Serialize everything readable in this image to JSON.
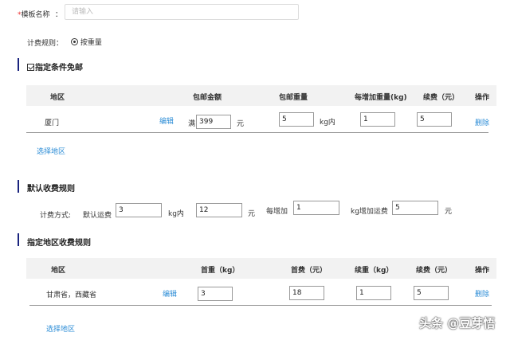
{
  "template_name": {
    "required_mark": "*",
    "label": "模板名称",
    "colon": "：",
    "placeholder": "请输入"
  },
  "billing_rule": {
    "label": "计费规则：",
    "option": "按重量"
  },
  "free_shipping": {
    "title": "指定条件免邮",
    "headers": [
      "地区",
      "包邮金额",
      "包邮重量",
      "每增加重量(kg)",
      "续费（元）",
      "操作"
    ],
    "row": {
      "region": "厦门",
      "edit": "编辑",
      "amount_prefix": "满",
      "amount": "399",
      "amount_unit": "元",
      "weight": "5",
      "weight_unit": "kg内",
      "per_weight": "1",
      "renew_fee": "5",
      "delete": "删除"
    },
    "select_region": "选择地区"
  },
  "default_rule": {
    "title": "默认收费规则",
    "method_label": "计费方式:",
    "default_fee_label": "默认运费",
    "default_weight": "3",
    "weight_unit": "kg内",
    "default_fee": "12",
    "fee_unit": "元",
    "each_add_label": "每增加",
    "each_add": "1",
    "add_fee_label": "kg增加运费",
    "add_fee": "5",
    "add_fee_unit": "元"
  },
  "region_rule": {
    "title": "指定地区收费规则",
    "headers": [
      "地区",
      "首重（kg）",
      "首费（元）",
      "续重（kg）",
      "续费（元）",
      "操作"
    ],
    "row": {
      "region": "甘肃省，西藏省",
      "edit": "编辑",
      "first_weight": "3",
      "first_fee": "18",
      "renew_weight": "1",
      "renew_fee": "5",
      "delete": "删除"
    },
    "select_region": "选择地区"
  },
  "watermark": "头条 @豆芽悟"
}
